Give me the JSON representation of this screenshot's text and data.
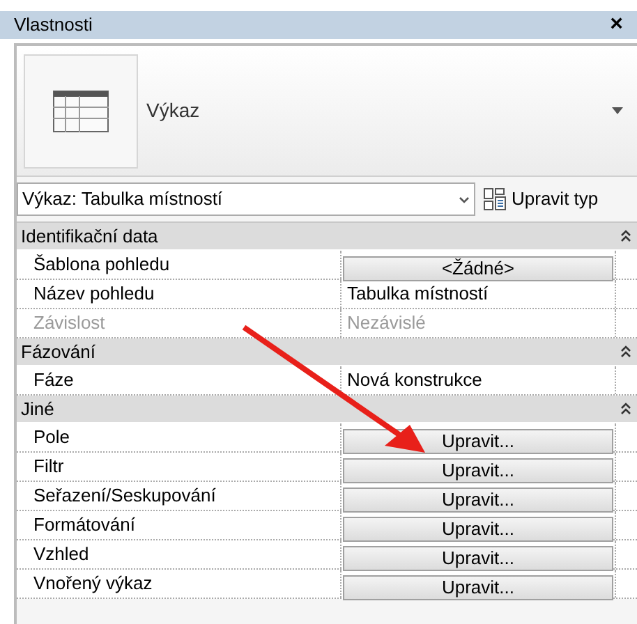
{
  "window": {
    "title": "Vlastnosti",
    "close": "×"
  },
  "type_selector": {
    "name": "Výkaz"
  },
  "instance_dropdown": {
    "value": "Výkaz: Tabulka místností"
  },
  "edit_type_button": {
    "label": "Upravit typ"
  },
  "sections": [
    {
      "title": "Identifikační data",
      "expanded": true,
      "rows": [
        {
          "label": "Šablona pohledu",
          "value": "<Žádné>",
          "kind": "button",
          "disabled": false
        },
        {
          "label": "Název pohledu",
          "value": "Tabulka místností",
          "kind": "text",
          "disabled": false
        },
        {
          "label": "Závislost",
          "value": "Nezávislé",
          "kind": "text",
          "disabled": true
        }
      ]
    },
    {
      "title": "Fázování",
      "expanded": true,
      "rows": [
        {
          "label": "Fáze",
          "value": "Nová konstrukce",
          "kind": "text",
          "disabled": false
        }
      ]
    },
    {
      "title": "Jiné",
      "expanded": true,
      "rows": [
        {
          "label": "Pole",
          "value": "Upravit...",
          "kind": "button",
          "disabled": false
        },
        {
          "label": "Filtr",
          "value": "Upravit...",
          "kind": "button",
          "disabled": false
        },
        {
          "label": "Seřazení/Seskupování",
          "value": "Upravit...",
          "kind": "button",
          "disabled": false
        },
        {
          "label": "Formátování",
          "value": "Upravit...",
          "kind": "button",
          "disabled": false
        },
        {
          "label": "Vzhled",
          "value": "Upravit...",
          "kind": "button",
          "disabled": false
        },
        {
          "label": "Vnořený výkaz",
          "value": "Upravit...",
          "kind": "button",
          "disabled": false
        }
      ]
    }
  ]
}
